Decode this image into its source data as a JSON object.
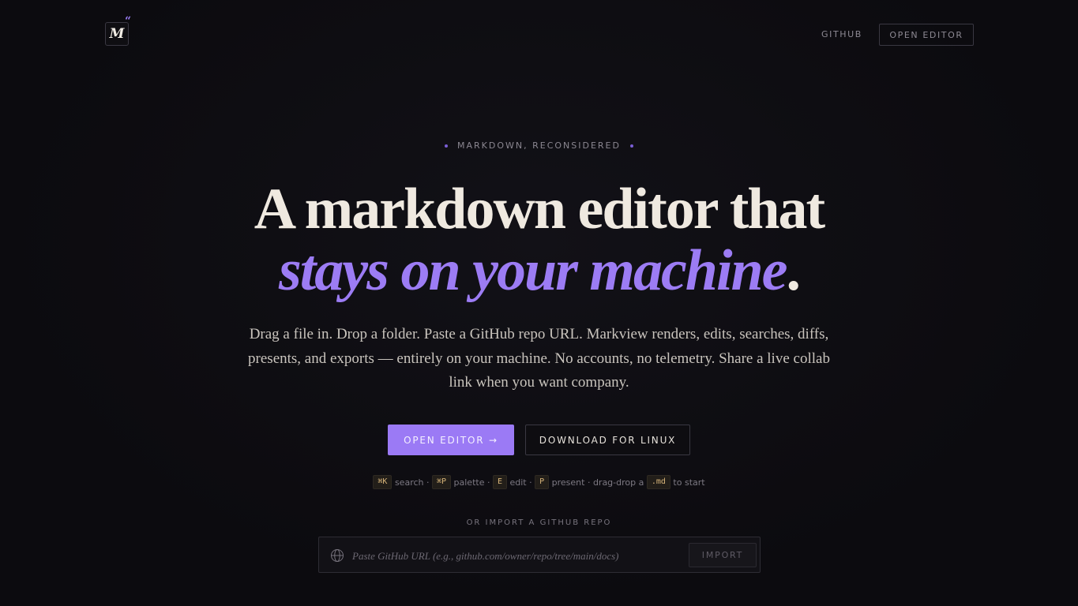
{
  "brand": {
    "logo_letter": "M",
    "logo_mark": "“"
  },
  "nav": {
    "github_label": "GITHUB",
    "open_editor_label": "OPEN EDITOR"
  },
  "hero": {
    "eyebrow": "MARKDOWN, RECONSIDERED",
    "headline_line1": "A markdown editor that",
    "headline_accent": "stays on your machine",
    "headline_period": ".",
    "description": "Drag a file in. Drop a folder. Paste a GitHub repo URL. Markview renders, edits, searches, diffs, presents, and exports — entirely on your machine. No accounts, no telemetry. Share a live collab link when you want company."
  },
  "cta": {
    "primary_label": "OPEN EDITOR →",
    "secondary_label": "DOWNLOAD FOR LINUX"
  },
  "shortcuts": [
    {
      "key": "⌘K",
      "text": " search · "
    },
    {
      "key": "⌘P",
      "text": " palette · "
    },
    {
      "key": "E",
      "text": " edit · "
    },
    {
      "key": "P",
      "text": " present · drag-drop a "
    },
    {
      "key": ".md",
      "text": " to start"
    }
  ],
  "import": {
    "label": "OR IMPORT A GITHUB REPO",
    "placeholder": "Paste GitHub URL (e.g., github.com/owner/repo/tree/main/docs)",
    "value": "",
    "button_label": "IMPORT",
    "icon": "globe-icon"
  },
  "colors": {
    "background": "#0d0c10",
    "accent": "#9b7af5",
    "text": "#efe9e0",
    "kbd_text": "#d8b57a"
  }
}
